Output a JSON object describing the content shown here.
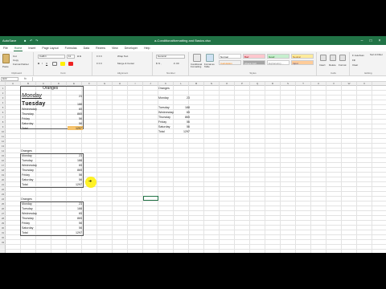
{
  "titlebar": {
    "autosave": "AutoSave",
    "title": "a-Conditionalformatting and Basics.xlsx",
    "search_placeholder": "Search"
  },
  "tabs": [
    "File",
    "Home",
    "Insert",
    "Page Layout",
    "Formulas",
    "Data",
    "Review",
    "View",
    "Developer",
    "Help"
  ],
  "ribbon": {
    "clipboard": {
      "paste": "Paste",
      "cut": "Cut",
      "copy": "Copy",
      "format_painter": "Format Painter",
      "label": "Clipboard"
    },
    "font": {
      "name": "Calibri",
      "size": "11",
      "label": "Font"
    },
    "alignment": {
      "wrap": "Wrap Text",
      "merge": "Merge & Center",
      "label": "Alignment"
    },
    "number": {
      "format": "General",
      "label": "Number"
    },
    "styles": {
      "cond_format": "Conditional Formatting",
      "format_table": "Format as Table",
      "cells": [
        "Normal",
        "Bad",
        "Good",
        "Neutral",
        "Calculation",
        "Check Cell",
        "Explanatory ...",
        "Input"
      ],
      "label": "Styles"
    },
    "cells": {
      "insert": "Insert",
      "delete": "Delete",
      "format": "Format",
      "label": "Cells"
    },
    "editing": {
      "autosum": "AutoSum",
      "fill": "Fill",
      "clear": "Clear",
      "sort": "Sort & Filter",
      "find": "Find & Select",
      "label": "Editing"
    }
  },
  "formula_bar": {
    "namebox": "H22",
    "fx": "fx",
    "value": ""
  },
  "columns": [
    "A",
    "B",
    "C",
    "D",
    "E",
    "F",
    "G",
    "H",
    "I",
    "J",
    "K",
    "L",
    "M",
    "N",
    "O",
    "P",
    "Q",
    "R",
    "S",
    "T",
    "U",
    "V",
    "W",
    "X"
  ],
  "rows": [
    "1",
    "2",
    "3",
    "4",
    "5",
    "6",
    "7",
    "8",
    "9",
    "10",
    "11",
    "12",
    "13",
    "14",
    "15",
    "16",
    "17",
    "18",
    "19",
    "20",
    "21",
    "22",
    "23",
    "24",
    "25",
    "26",
    "27",
    "28",
    "29",
    "30",
    "31",
    "32",
    "33"
  ],
  "table1": {
    "title": "Oranges",
    "rows": [
      {
        "day": "Monday",
        "value": "23"
      },
      {
        "day": "Tuesday",
        "value": "188"
      },
      {
        "day": "Wednesday",
        "value": "65"
      },
      {
        "day": "Thursday",
        "value": "865"
      },
      {
        "day": "Friday",
        "value": "56"
      },
      {
        "day": "Saturday",
        "value": "56"
      },
      {
        "day": "Total",
        "value": "1297"
      }
    ]
  },
  "table2": {
    "title": "Oranges",
    "rows": [
      {
        "day": "Monday",
        "value": "23"
      },
      {
        "day": "Tuesday",
        "value": "188"
      },
      {
        "day": "Wednesday",
        "value": "65"
      },
      {
        "day": "Thursday",
        "value": "865"
      },
      {
        "day": "Friday",
        "value": "56"
      },
      {
        "day": "Saturday",
        "value": "56"
      },
      {
        "day": "Total",
        "value": "1297"
      }
    ]
  },
  "table3": {
    "title": "Oranges",
    "rows": [
      {
        "day": "Monday",
        "value": "23"
      },
      {
        "day": "Tuesday",
        "value": "188"
      },
      {
        "day": "Wednesday",
        "value": "65"
      },
      {
        "day": "Thursday",
        "value": "865"
      },
      {
        "day": "Friday",
        "value": "56"
      },
      {
        "day": "Saturday",
        "value": "56"
      },
      {
        "day": "Total",
        "value": "1297"
      }
    ]
  },
  "table4": {
    "title": "Oranges",
    "rows": [
      {
        "day": "Monday",
        "value": "23"
      },
      {
        "day": "Tuesday",
        "value": "188"
      },
      {
        "day": "Wednesday",
        "value": "65"
      },
      {
        "day": "Thursday",
        "value": "865"
      },
      {
        "day": "Friday",
        "value": "56"
      },
      {
        "day": "Saturday",
        "value": "56"
      },
      {
        "day": "Total",
        "value": "1297"
      }
    ]
  },
  "colors": {
    "excel_green": "#217346",
    "total_highlight": "#f5c26b",
    "bad": "#ffc7ce",
    "good": "#c6efce",
    "neutral": "#ffeb9c"
  }
}
